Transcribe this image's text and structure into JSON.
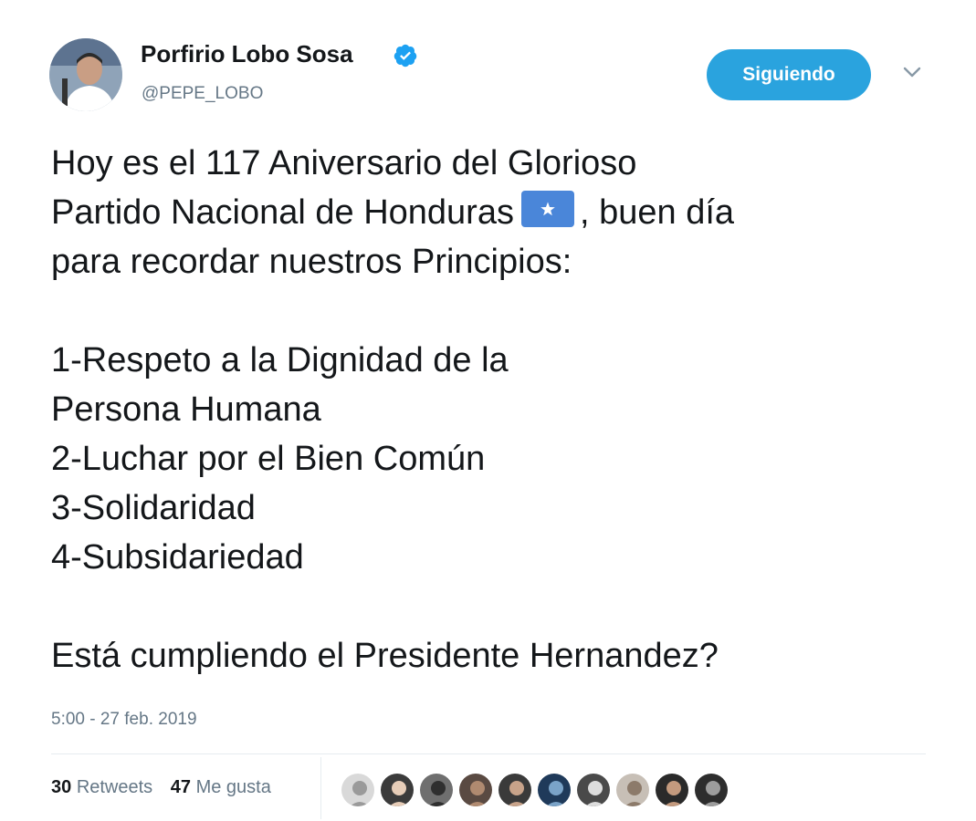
{
  "author": {
    "name": "Porfirio Lobo Sosa",
    "handle": "@PEPE_LOBO",
    "verified": true
  },
  "follow_button": {
    "label": "Siguiendo"
  },
  "tweet": {
    "lines": [
      "Hoy es el 117 Aniversario del Glorioso",
      "Partido Nacional de Honduras",
      ", buen día",
      "para recordar nuestros Principios:",
      "1-Respeto a la Dignidad de la",
      "Persona Humana",
      "2-Luchar por el Bien Común",
      "3-Solidaridad",
      "4-Subsidariedad",
      "Está cumpliendo el Presidente Hernandez?"
    ],
    "emoji": "flag-honduras-icon"
  },
  "timestamp": "5:00 - 27 feb. 2019",
  "stats": {
    "retweets_count": "30",
    "retweets_label": "Retweets",
    "likes_count": "47",
    "likes_label": "Me gusta"
  },
  "liker_avatars": 10,
  "colors": {
    "accent": "#2aa3de",
    "text": "#14171a",
    "secondary": "#657786",
    "divider": "#e6ecf0"
  }
}
